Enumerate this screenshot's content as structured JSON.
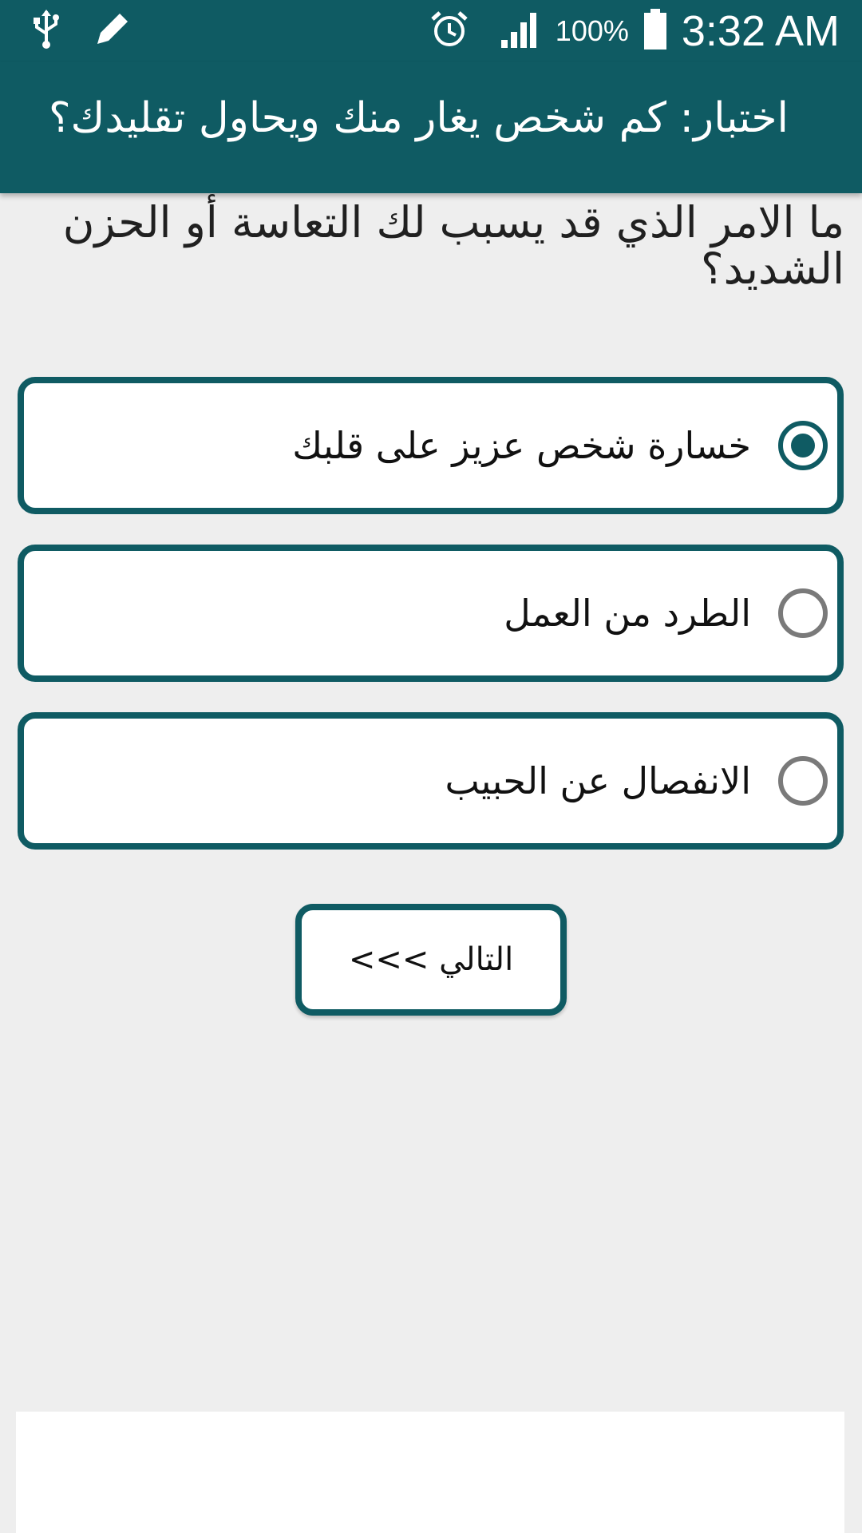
{
  "status_bar": {
    "battery_pct": "100%",
    "time": "3:32 AM",
    "icons": [
      "usb-icon",
      "pencil-icon",
      "alarm-icon",
      "signal-icon",
      "battery-icon"
    ]
  },
  "app_bar": {
    "title": "اختبار: كم شخص يغار منك ويحاول تقليدك؟"
  },
  "question": {
    "text": "ما الامر الذي قد يسبب لك التعاسة أو الحزن الشديد؟"
  },
  "options": [
    {
      "label": "خسارة شخص عزيز على قلبك",
      "selected": true
    },
    {
      "label": "الطرد من العمل",
      "selected": false
    },
    {
      "label": "الانفصال عن الحبيب",
      "selected": false
    }
  ],
  "next_button": {
    "label": "التالي >>>"
  },
  "colors": {
    "primary": "#0f5b63",
    "background": "#eeeeee"
  }
}
